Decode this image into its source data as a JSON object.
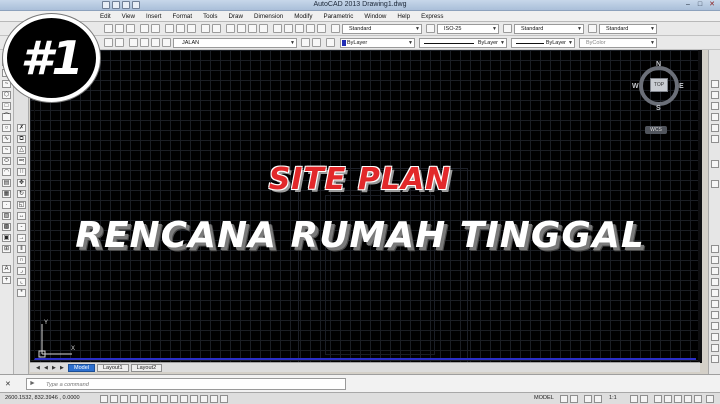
{
  "window": {
    "title": "AutoCAD 2013    Drawing1.dwg"
  },
  "menu": {
    "items": [
      "Edit",
      "View",
      "Insert",
      "Format",
      "Tools",
      "Draw",
      "Dimension",
      "Modify",
      "Parametric",
      "Window",
      "Help",
      "Express"
    ]
  },
  "toolbar": {
    "text_style": "Standard",
    "dim_style": "ISO-25",
    "table_style": "Standard",
    "multileader_style": "Standard",
    "layer": "JALAN",
    "color": "ByLayer",
    "linetype": "ByLayer",
    "lineweight": "ByLayer",
    "plot_style": "ByColor"
  },
  "viewcube": {
    "north": "N",
    "south": "S",
    "east": "E",
    "west": "W",
    "face": "TOP",
    "wcs_label": "WCS"
  },
  "ucs": {
    "x_label": "X",
    "y_label": "Y"
  },
  "overlay": {
    "badge": "#1",
    "headline_1": "SITE PLAN",
    "headline_2": "RENCANA RUMAH TINGGAL"
  },
  "layout_tabs": [
    {
      "label": "Model",
      "active": true
    },
    {
      "label": "Layout1",
      "active": false
    },
    {
      "label": "Layout2",
      "active": false
    }
  ],
  "command": {
    "placeholder": "Type a command"
  },
  "status": {
    "coordinates": "2600.1532, 832.3946 , 0.0000",
    "model": "MODEL",
    "scale": "1:1"
  },
  "colors": {
    "headline_1": "#e2282a",
    "headline_2": "#ffffff",
    "canvas": "#000000",
    "bylayer_swatch": "#1f2cb4"
  },
  "icons": [
    "application-icon",
    "minimize-icon",
    "maximize-icon",
    "close-icon",
    "compass-icon",
    "ucs-icon",
    "command-close-icon",
    "command-recent-icon"
  ]
}
